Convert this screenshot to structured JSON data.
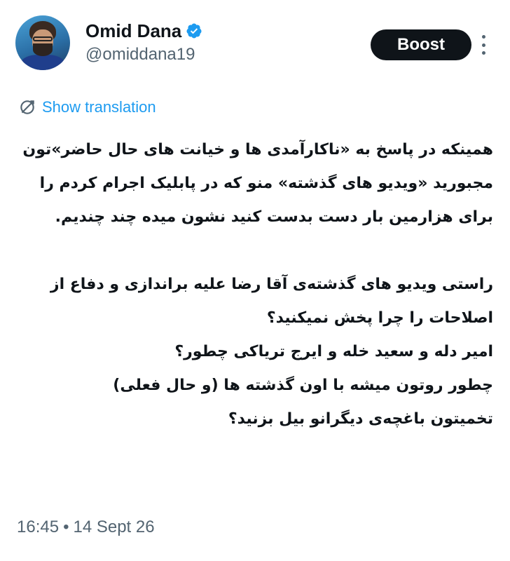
{
  "author": {
    "display_name": "Omid Dana",
    "handle": "@omiddana19",
    "verified": true,
    "avatar_icon": "profile-photo"
  },
  "actions": {
    "boost_label": "Boost",
    "more_icon": "vertical-ellipsis"
  },
  "translation": {
    "label": "Show translation",
    "icon": "translate-icon"
  },
  "tweet": {
    "paragraph_1": "همینکه در پاسخ به «ناکارآمدی ها و خیانت های حال حاضر»تون مجبورید «ویدیو های گذشته» منو که در پابلیک اجرام کردم را برای هزارمین بار دست بدست کنید نشون میده چند چندیم.",
    "paragraph_2": "راستی ویدیو های گذشته‌ی آقا رضا علیه براندازی و دفاع از اصلاحات را چرا پخش نمیکنید؟",
    "line_3": "امیر دله و سعید خله و ایرج تریاکی چطور؟",
    "line_4": "چطور روتون میشه با اون گذشته ها (و حال فعلی)",
    "line_5": "تخمیتون باغچه‌ی دیگرانو بیل بزنید؟"
  },
  "meta": {
    "time": "16:45",
    "separator": "•",
    "date": "14 Sept 26"
  },
  "colors": {
    "text": "#0f1419",
    "secondary": "#536471",
    "link": "#1d9bf0",
    "button_bg": "#0f1419"
  }
}
